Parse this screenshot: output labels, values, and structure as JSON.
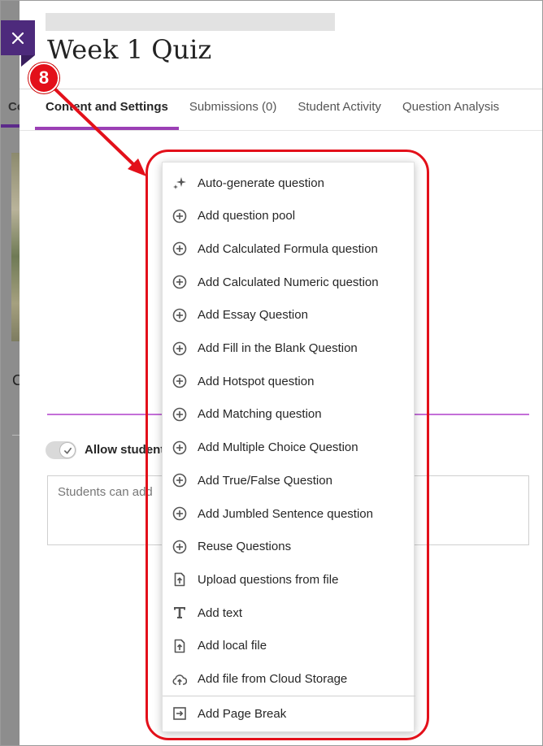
{
  "panel": {
    "title": "Week 1 Quiz"
  },
  "background": {
    "tab_partial": "Co",
    "letter_partial": "C"
  },
  "tabs": [
    {
      "label": "Content and Settings",
      "active": true
    },
    {
      "label": "Submissions (0)",
      "active": false
    },
    {
      "label": "Student Activity",
      "active": false
    },
    {
      "label": "Question Analysis",
      "active": false
    }
  ],
  "content": {
    "allow_label": "Allow student",
    "notes_placeholder": "Students can add"
  },
  "menu": {
    "items": [
      {
        "label": "Auto-generate question",
        "icon": "sparkle-icon"
      },
      {
        "label": "Add question pool",
        "icon": "plus-circle-icon"
      },
      {
        "label": "Add Calculated Formula question",
        "icon": "plus-circle-icon"
      },
      {
        "label": "Add Calculated Numeric question",
        "icon": "plus-circle-icon"
      },
      {
        "label": "Add Essay Question",
        "icon": "plus-circle-icon"
      },
      {
        "label": "Add Fill in the Blank Question",
        "icon": "plus-circle-icon"
      },
      {
        "label": "Add Hotspot question",
        "icon": "plus-circle-icon"
      },
      {
        "label": "Add Matching question",
        "icon": "plus-circle-icon"
      },
      {
        "label": "Add Multiple Choice Question",
        "icon": "plus-circle-icon"
      },
      {
        "label": "Add True/False Question",
        "icon": "plus-circle-icon"
      },
      {
        "label": "Add Jumbled Sentence question",
        "icon": "plus-circle-icon"
      },
      {
        "label": "Reuse Questions",
        "icon": "plus-circle-icon"
      },
      {
        "label": "Upload questions from file",
        "icon": "file-upload-icon"
      },
      {
        "label": "Add text",
        "icon": "text-icon"
      },
      {
        "label": "Add local file",
        "icon": "file-upload-icon"
      },
      {
        "label": "Add file from Cloud Storage",
        "icon": "cloud-upload-icon"
      }
    ],
    "page_break": {
      "label": "Add Page Break",
      "icon": "page-break-icon"
    }
  },
  "annotation": {
    "step_number": "8",
    "color": "#e3101a"
  },
  "colors": {
    "accent": "#9b3fb5",
    "close_button": "#4d2a7c"
  }
}
